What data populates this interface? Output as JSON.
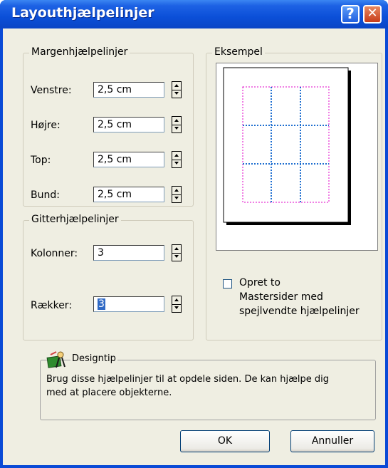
{
  "window": {
    "title": "Layouthjælpelinjer",
    "help_glyph": "?",
    "close_glyph": "✕"
  },
  "margins": {
    "legend": "Margenhjælpelinjer",
    "rows": [
      {
        "label": "Venstre:",
        "value": "2,5 cm"
      },
      {
        "label": "Højre:",
        "value": "2,5 cm"
      },
      {
        "label": "Top:",
        "value": "2,5 cm"
      },
      {
        "label": "Bund:",
        "value": "2,5 cm"
      }
    ]
  },
  "grid": {
    "legend": "Gitterhjælpelinjer",
    "columns_label": "Kolonner:",
    "columns_value": "3",
    "rows_label": "Rækker:",
    "rows_value": "3"
  },
  "preview": {
    "legend": "Eksempel",
    "checkbox_checked": false,
    "checkbox_label_lines": [
      "Opret to",
      "Mastersider med",
      "spejlvendte hjælpelinjer"
    ],
    "margin_guide_color": "#e000c8",
    "grid_guide_color": "#1f6fd0"
  },
  "tip": {
    "title": "Designtip",
    "text_lines": [
      "Brug disse hjælpelinjer til at opdele siden. De kan hjælpe dig",
      "med at placere objekterne."
    ]
  },
  "buttons": {
    "ok": "OK",
    "cancel": "Annuller"
  }
}
